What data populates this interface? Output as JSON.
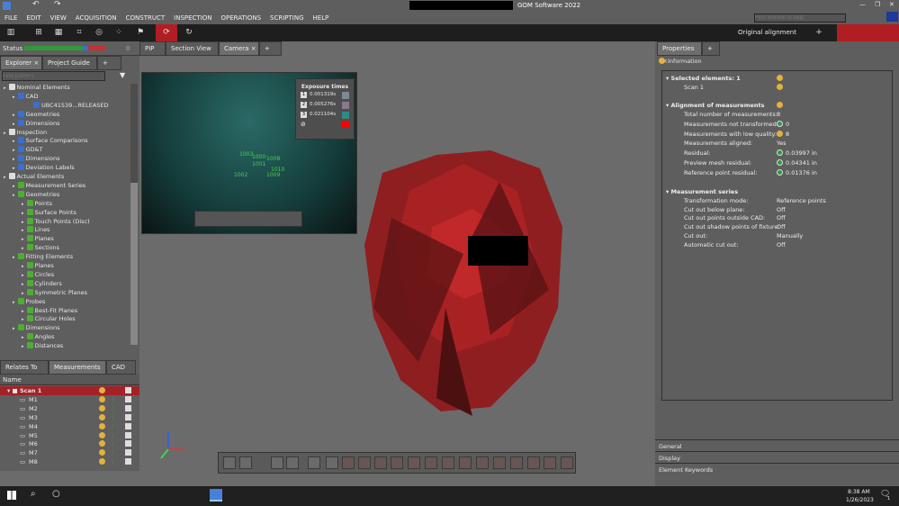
{
  "app": {
    "title": "GOM Software 2022"
  },
  "menu": [
    "FILE",
    "EDIT",
    "VIEW",
    "ACQUISITION",
    "CONSTRUCT",
    "INSPECTION",
    "OPERATIONS",
    "SCRIPTING",
    "HELP"
  ],
  "search": {
    "placeholder": "Find function or help"
  },
  "alignment": {
    "label": "Original alignment"
  },
  "status": {
    "label": "Status",
    "count": "0"
  },
  "view_tabs": [
    "PIP",
    "Section View",
    "Camera"
  ],
  "explorer": {
    "tabs": [
      "Explorer",
      "Project Guide"
    ],
    "find_placeholder": "Find (Ctrl+F)",
    "tree": [
      {
        "label": "Nominal Elements",
        "level": 0,
        "color": "#dddddd"
      },
      {
        "label": "CAD",
        "level": 1,
        "color": "#3a6fd0"
      },
      {
        "label": "UBC41539...RELEASED",
        "level": 3,
        "color": "#3a6fd0"
      },
      {
        "label": "Geometries",
        "level": 1,
        "color": "#3a6fd0"
      },
      {
        "label": "Dimensions",
        "level": 1,
        "color": "#3a6fd0"
      },
      {
        "label": "Inspection",
        "level": 0,
        "color": "#dddddd"
      },
      {
        "label": "Surface Comparisons",
        "level": 1,
        "color": "#3a6fd0"
      },
      {
        "label": "GD&T",
        "level": 1,
        "color": "#3a6fd0"
      },
      {
        "label": "Dimensions",
        "level": 1,
        "color": "#3a6fd0"
      },
      {
        "label": "Deviation Labels",
        "level": 1,
        "color": "#3a6fd0"
      },
      {
        "label": "Actual Elements",
        "level": 0,
        "color": "#dddddd"
      },
      {
        "label": "Measurement Series",
        "level": 1,
        "color": "#4caf30"
      },
      {
        "label": "Geometries",
        "level": 1,
        "color": "#4caf30"
      },
      {
        "label": "Points",
        "level": 2,
        "color": "#4caf30"
      },
      {
        "label": "Surface Points",
        "level": 2,
        "color": "#4caf30"
      },
      {
        "label": "Touch Points (Disc)",
        "level": 2,
        "color": "#4caf30"
      },
      {
        "label": "Lines",
        "level": 2,
        "color": "#4caf30"
      },
      {
        "label": "Planes",
        "level": 2,
        "color": "#4caf30"
      },
      {
        "label": "Sections",
        "level": 2,
        "color": "#4caf30"
      },
      {
        "label": "Fitting Elements",
        "level": 1,
        "color": "#4caf30"
      },
      {
        "label": "Planes",
        "level": 2,
        "color": "#4caf30"
      },
      {
        "label": "Circles",
        "level": 2,
        "color": "#4caf30"
      },
      {
        "label": "Cylinders",
        "level": 2,
        "color": "#4caf30"
      },
      {
        "label": "Symmetric Planes",
        "level": 2,
        "color": "#4caf30"
      },
      {
        "label": "Probes",
        "level": 1,
        "color": "#4caf30"
      },
      {
        "label": "Best-Fit Planes",
        "level": 2,
        "color": "#4caf30"
      },
      {
        "label": "Circular Holes",
        "level": 2,
        "color": "#4caf30"
      },
      {
        "label": "Dimensions",
        "level": 1,
        "color": "#4caf30"
      },
      {
        "label": "Angles",
        "level": 2,
        "color": "#4caf30"
      },
      {
        "label": "Distances",
        "level": 2,
        "color": "#4caf30"
      }
    ]
  },
  "bottom_tabs": [
    "Relates To",
    "Measurements",
    "CAD Bo"
  ],
  "measurements": {
    "header": "Name",
    "scan": "Scan 1",
    "items": [
      "M1",
      "M2",
      "M3",
      "M4",
      "M5",
      "M6",
      "M7",
      "M8"
    ]
  },
  "camera": {
    "exposure_title": "Exposure times",
    "exposures": [
      {
        "n": "1",
        "value": "0.001319s",
        "color": "#7c8a96"
      },
      {
        "n": "2",
        "value": "0.005276s",
        "color": "#8a7890"
      },
      {
        "n": "3",
        "value": "0.021104s",
        "color": "#2e8a86"
      }
    ],
    "overflow_color": "#ff0000",
    "point_labels": [
      "1003",
      "1000",
      "1001",
      "1008",
      "1010",
      "1002",
      "1009"
    ]
  },
  "properties": {
    "tabs": [
      "Properties"
    ],
    "info_label": "Information",
    "selected": {
      "title": "Selected elements:  1",
      "item": "Scan 1"
    },
    "alignment": {
      "title": "Alignment of measurements",
      "rows": [
        {
          "k": "Total number of measurements:",
          "v": "8",
          "icon": ""
        },
        {
          "k": "Measurements not transformed:",
          "v": "0",
          "icon": "green"
        },
        {
          "k": "Measurements with low quality:",
          "v": "8",
          "icon": "yellow"
        },
        {
          "k": "Measurements aligned:",
          "v": "Yes",
          "icon": ""
        },
        {
          "k": "Residual:",
          "v": "0.03997 in",
          "icon": "green"
        },
        {
          "k": "Preview mesh residual:",
          "v": "0.04341 in",
          "icon": "green"
        },
        {
          "k": "Reference point residual:",
          "v": "0.01376 in",
          "icon": "green"
        }
      ]
    },
    "series": {
      "title": "Measurement series",
      "rows": [
        {
          "k": "Transformation mode:",
          "v": "Reference points"
        },
        {
          "k": "Cut out below plane:",
          "v": "Off"
        },
        {
          "k": "Cut out points outside CAD:",
          "v": "Off"
        },
        {
          "k": "Cut out shadow points of fixture:",
          "v": "Off"
        },
        {
          "k": "Cut out:",
          "v": "Manually"
        },
        {
          "k": "Automatic cut out:",
          "v": "Off"
        }
      ]
    },
    "sections": [
      "General",
      "Display",
      "Element Keywords"
    ]
  },
  "taskbar": {
    "time": "8:38 AM",
    "date": "1/26/2023",
    "notifications": "1"
  }
}
